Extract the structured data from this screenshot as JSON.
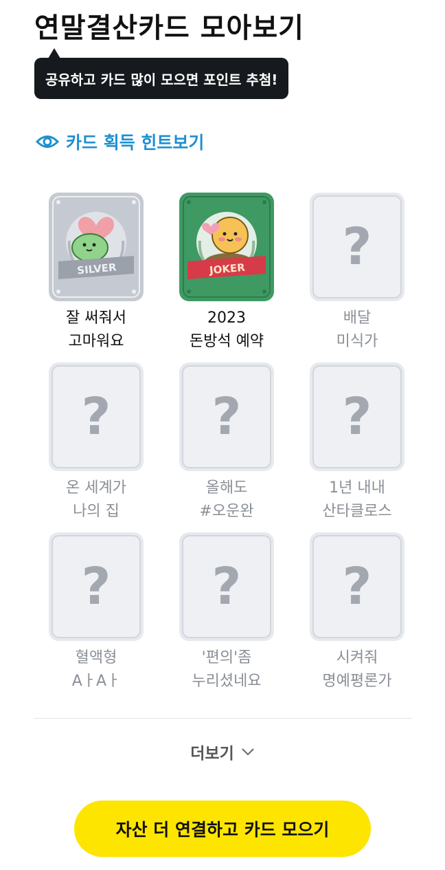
{
  "page": {
    "title": "연말결산카드 모아보기"
  },
  "tooltip": {
    "text": "공유하고 카드 많이 모으면 포인트 추첨!"
  },
  "hint_link": {
    "label": "카드 획득 힌트보기",
    "icon": "eye-icon",
    "color": "#1f8fd0"
  },
  "cards": [
    {
      "line1": "잘 써줘서",
      "line2": "고마워요",
      "acquired": true,
      "badge": "SILVER"
    },
    {
      "line1": "2023",
      "line2": "돈방석 예약",
      "acquired": true,
      "badge": "JOKER"
    },
    {
      "line1": "배달",
      "line2": "미식가",
      "acquired": false,
      "symbol": "?"
    },
    {
      "line1": "온 세계가",
      "line2": "나의 집",
      "acquired": false,
      "symbol": "?"
    },
    {
      "line1": "올해도",
      "line2": "#오운완",
      "acquired": false,
      "symbol": "?"
    },
    {
      "line1": "1년 내내",
      "line2": "산타클로스",
      "acquired": false,
      "symbol": "?"
    },
    {
      "line1": "혈액형",
      "line2": "AㅏAㅏ",
      "acquired": false,
      "symbol": "?"
    },
    {
      "line1": "'편의'좀",
      "line2": "누리셨네요",
      "acquired": false,
      "symbol": "?"
    },
    {
      "line1": "시켜줘",
      "line2": "명예평론가",
      "acquired": false,
      "symbol": "?"
    }
  ],
  "more_button": {
    "label": "더보기",
    "icon": "chevron-down-icon"
  },
  "cta_button": {
    "label": "자산 더 연결하고 카드 모으기",
    "color": "#fde500"
  }
}
